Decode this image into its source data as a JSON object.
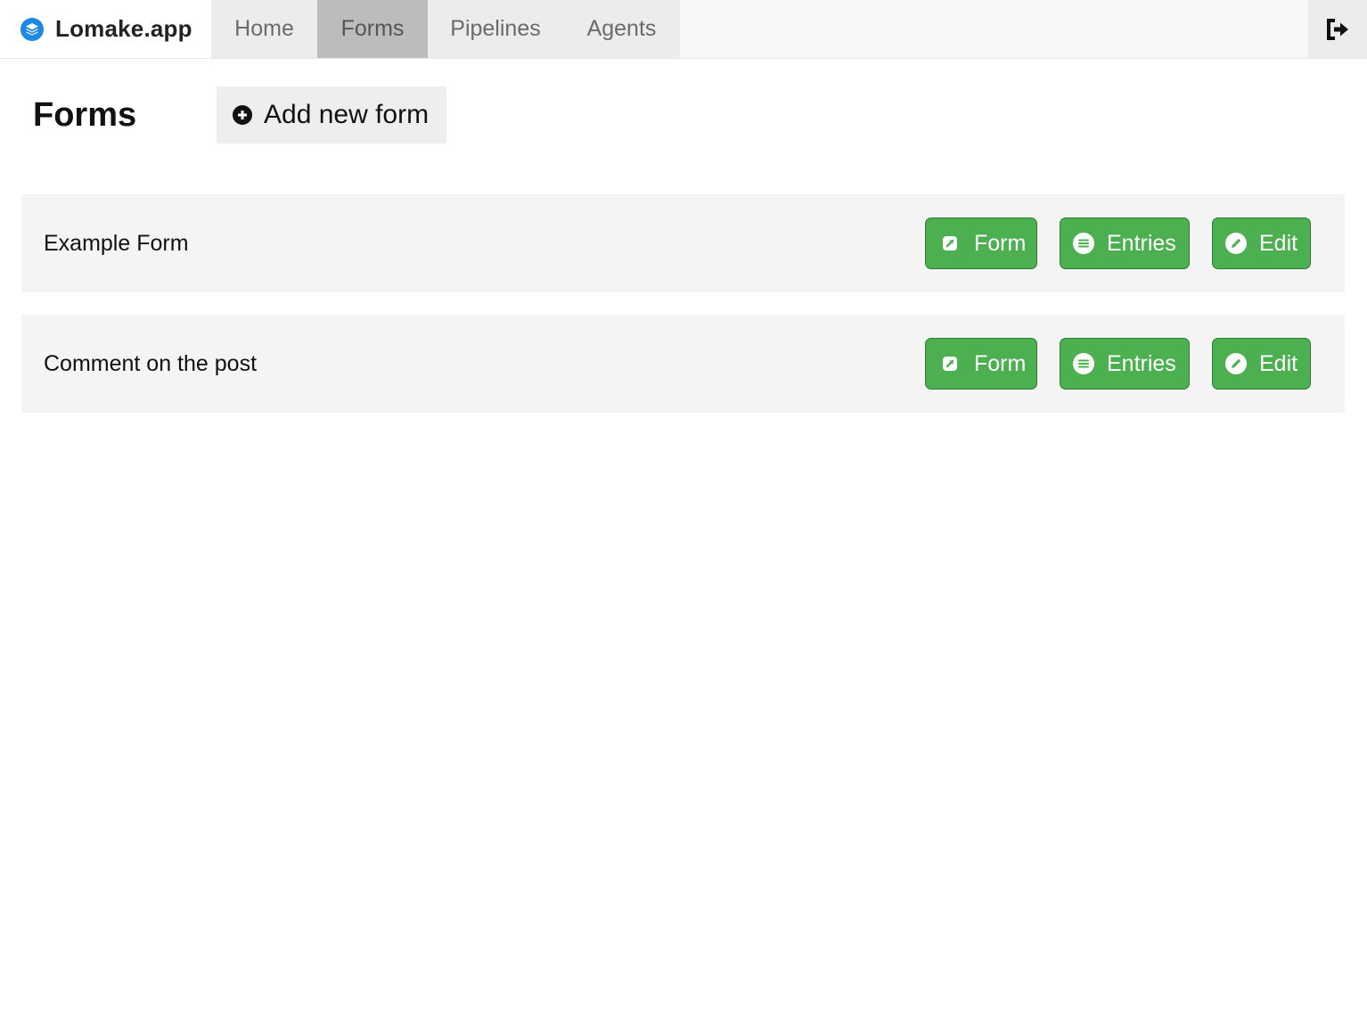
{
  "brand": {
    "name": "Lomake.app"
  },
  "nav": {
    "items": [
      {
        "label": "Home",
        "active": false
      },
      {
        "label": "Forms",
        "active": true
      },
      {
        "label": "Pipelines",
        "active": false
      },
      {
        "label": "Agents",
        "active": false
      }
    ],
    "logout_icon": "logout-icon"
  },
  "page": {
    "title": "Forms",
    "add_button_label": "Add new form",
    "add_button_icon": "plus-circle-icon"
  },
  "forms": [
    {
      "name": "Example Form",
      "actions": {
        "form": "Form",
        "entries": "Entries",
        "edit": "Edit"
      }
    },
    {
      "name": "Comment on the post",
      "actions": {
        "form": "Form",
        "entries": "Entries",
        "edit": "Edit"
      }
    }
  ],
  "icons": {
    "form": "external-link-icon",
    "entries": "list-circle-icon",
    "edit": "pencil-circle-icon"
  },
  "colors": {
    "accent_green": "#4caf50",
    "green_border": "#2e7d32",
    "brand_blue": "#1e88e5",
    "nav_active": "#bcbcbc",
    "row_background": "#f4f4f4"
  }
}
